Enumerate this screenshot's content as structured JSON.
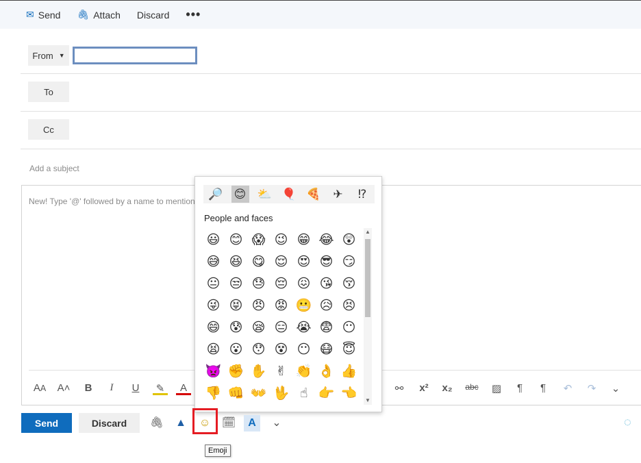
{
  "toolbar": {
    "send_label": "Send",
    "attach_label": "Attach",
    "discard_label": "Discard",
    "more_label": "•••"
  },
  "header": {
    "from_label": "From",
    "from_value": "",
    "to_label": "To",
    "cc_label": "Cc",
    "subject_placeholder": "Add a subject",
    "body_placeholder": "New! Type '@' followed by a name to mention"
  },
  "emoji_picker": {
    "categories": [
      {
        "name": "search-icon",
        "glyph": "🔎"
      },
      {
        "name": "people-category-icon",
        "glyph": "😊"
      },
      {
        "name": "weather-category-icon",
        "glyph": "⛅"
      },
      {
        "name": "activity-category-icon",
        "glyph": "🎈"
      },
      {
        "name": "food-category-icon",
        "glyph": "🍕"
      },
      {
        "name": "travel-category-icon",
        "glyph": "✈"
      },
      {
        "name": "symbols-category-icon",
        "glyph": "⁉"
      }
    ],
    "section_title": "People and faces",
    "emojis": [
      "😃",
      "😊",
      "😱",
      "😉",
      "😁",
      "😂",
      "😲",
      "😅",
      "😆",
      "😋",
      "😌",
      "😍",
      "😎",
      "😏",
      "😐",
      "😒",
      "😓",
      "😔",
      "😖",
      "😘",
      "😚",
      "😜",
      "😝",
      "😠",
      "😡",
      "😬",
      "😥",
      "😣",
      "😄",
      "😰",
      "😪",
      "😑",
      "😭",
      "😨",
      "😶",
      "😫",
      "😮",
      "😯",
      "😵",
      "😶",
      "😷",
      "😇",
      "👿",
      "✊",
      "✋",
      "✌",
      "👏",
      "👌",
      "👍",
      "👎",
      "👊",
      "👐",
      "🖖",
      "☝",
      "👉",
      "👈"
    ]
  },
  "bottom": {
    "send_label": "Send",
    "discard_label": "Discard",
    "tooltip": "Emoji"
  }
}
